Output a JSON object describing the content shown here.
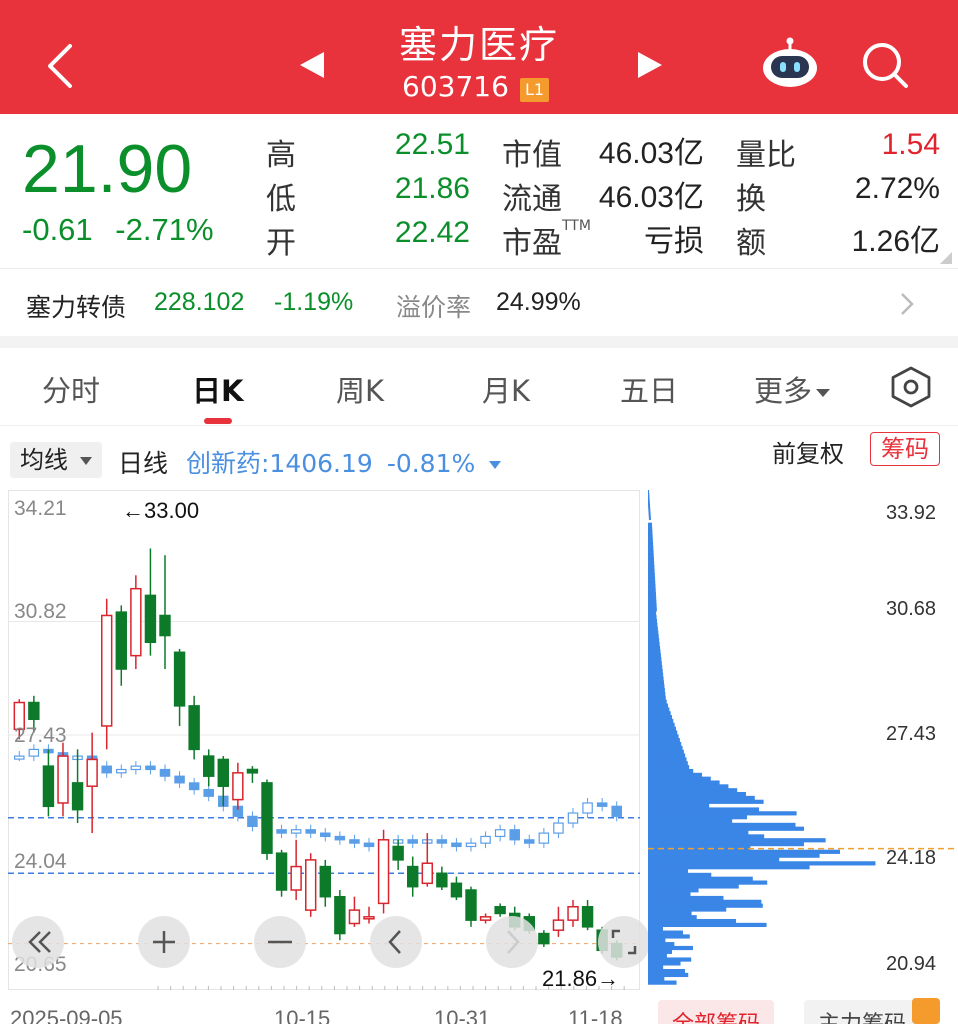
{
  "header": {
    "title": "塞力医疗",
    "code": "603716",
    "level_badge": "L1"
  },
  "quote": {
    "price": "21.90",
    "change": "-0.61",
    "change_pct": "-2.71%",
    "stats": [
      {
        "label": "高",
        "value": "22.51",
        "color": "green"
      },
      {
        "label": "低",
        "value": "21.86",
        "color": "green"
      },
      {
        "label": "开",
        "value": "22.42",
        "color": "green"
      },
      {
        "label": "市值",
        "value": "46.03亿",
        "color": "dark"
      },
      {
        "label": "流通",
        "value": "46.03亿",
        "color": "dark"
      },
      {
        "label": "市盈",
        "value": "亏损",
        "color": "dark",
        "superscript": "TTM"
      },
      {
        "label": "量比",
        "value": "1.54",
        "color": "red"
      },
      {
        "label": "换",
        "value": "2.72%",
        "color": "dark"
      },
      {
        "label": "额",
        "value": "1.26亿",
        "color": "dark"
      }
    ]
  },
  "bond": {
    "name": "塞力转债",
    "price": "228.102",
    "change_pct": "-1.19%",
    "premium_label": "溢价率",
    "premium_value": "24.99%"
  },
  "tabs": [
    {
      "label": "分时",
      "active": false
    },
    {
      "label": "日K",
      "active": true
    },
    {
      "label": "周K",
      "active": false
    },
    {
      "label": "月K",
      "active": false
    },
    {
      "label": "五日",
      "active": false
    },
    {
      "label": "更多",
      "active": false
    }
  ],
  "indicator": {
    "ma_button": "均线",
    "period": "日线",
    "sector": "创新药:1406.19",
    "sector_change": "-0.81%",
    "adjust": "前复权",
    "chips": "筹码"
  },
  "chart_data": {
    "type": "candlestick",
    "y_ticks_left": [
      "34.21",
      "30.82",
      "27.43",
      "24.04",
      "20.65"
    ],
    "y_ticks_right": [
      "33.92",
      "30.68",
      "27.43",
      "24.18",
      "20.94"
    ],
    "ylim": [
      20.65,
      34.21
    ],
    "annotations": {
      "high": "←33.00",
      "low": "21.86→"
    },
    "x_ticks": [
      "2025-09-05",
      "10-15",
      "10-31",
      "11-18"
    ],
    "reference_lines": [
      24.96,
      23.3
    ],
    "cost_line": 24.18,
    "candles": [
      [
        27.6,
        28.4,
        27.3,
        28.5
      ],
      [
        28.4,
        27.9,
        27.5,
        28.6
      ],
      [
        26.5,
        25.3,
        25.0,
        27.0
      ],
      [
        25.4,
        26.8,
        25.0,
        27.2
      ],
      [
        26.0,
        25.2,
        24.8,
        27.0
      ],
      [
        25.9,
        26.7,
        24.5,
        27.5
      ],
      [
        27.7,
        31.0,
        27.0,
        31.5
      ],
      [
        31.1,
        29.4,
        28.9,
        31.3
      ],
      [
        29.8,
        31.8,
        29.4,
        32.2
      ],
      [
        31.6,
        30.2,
        29.8,
        33.0
      ],
      [
        31.0,
        30.4,
        29.4,
        32.8
      ],
      [
        29.9,
        28.3,
        27.7,
        30.0
      ],
      [
        28.3,
        27.0,
        26.7,
        28.6
      ],
      [
        26.8,
        26.2,
        25.9,
        27.0
      ],
      [
        26.7,
        25.9,
        25.3,
        26.8
      ],
      [
        25.5,
        26.3,
        25.2,
        26.6
      ],
      [
        26.4,
        26.3,
        26.0,
        26.5
      ],
      [
        26.0,
        23.9,
        23.7,
        26.1
      ],
      [
        23.9,
        22.8,
        22.6,
        24.0
      ],
      [
        22.8,
        23.5,
        22.5,
        24.3
      ],
      [
        22.2,
        23.7,
        22.0,
        23.9
      ],
      [
        23.5,
        22.6,
        22.3,
        23.7
      ],
      [
        22.6,
        21.5,
        21.3,
        22.8
      ],
      [
        21.8,
        22.2,
        21.7,
        22.6
      ],
      [
        22.0,
        22.0,
        21.8,
        22.3
      ],
      [
        22.4,
        24.3,
        22.1,
        24.6
      ],
      [
        24.1,
        23.7,
        23.4,
        24.3
      ],
      [
        23.5,
        22.9,
        22.6,
        23.8
      ],
      [
        23.0,
        23.6,
        22.9,
        24.5
      ],
      [
        23.3,
        22.9,
        22.8,
        23.5
      ],
      [
        23.0,
        22.6,
        22.5,
        23.2
      ],
      [
        22.8,
        21.9,
        21.7,
        22.9
      ],
      [
        21.9,
        22.0,
        21.8,
        22.1
      ],
      [
        22.3,
        22.1,
        22.0,
        22.4
      ],
      [
        22.1,
        21.7,
        21.6,
        22.3
      ],
      [
        22.0,
        21.6,
        21.5,
        22.1
      ],
      [
        21.5,
        21.2,
        21.1,
        21.6
      ],
      [
        21.6,
        21.9,
        21.4,
        22.3
      ],
      [
        21.9,
        22.3,
        21.7,
        22.5
      ],
      [
        22.3,
        21.7,
        21.6,
        22.5
      ],
      [
        21.6,
        21.0,
        20.9,
        21.7
      ],
      [
        21.2,
        20.8,
        20.7,
        21.3
      ]
    ],
    "sector_line": [
      26.8,
      27.0,
      26.9,
      26.7,
      26.8,
      26.5,
      26.3,
      26.4,
      26.5,
      26.4,
      26.2,
      26.0,
      25.8,
      25.6,
      25.3,
      25.0,
      24.7,
      24.6,
      24.5,
      24.6,
      24.5,
      24.4,
      24.3,
      24.2,
      24.1,
      24.2,
      24.3,
      24.2,
      24.3,
      24.2,
      24.1,
      24.2,
      24.4,
      24.6,
      24.3,
      24.2,
      24.5,
      24.8,
      25.1,
      25.4,
      25.3,
      25.0
    ]
  },
  "distribution": {
    "legend_all": "全部筹码",
    "legend_main": "主力筹码"
  }
}
